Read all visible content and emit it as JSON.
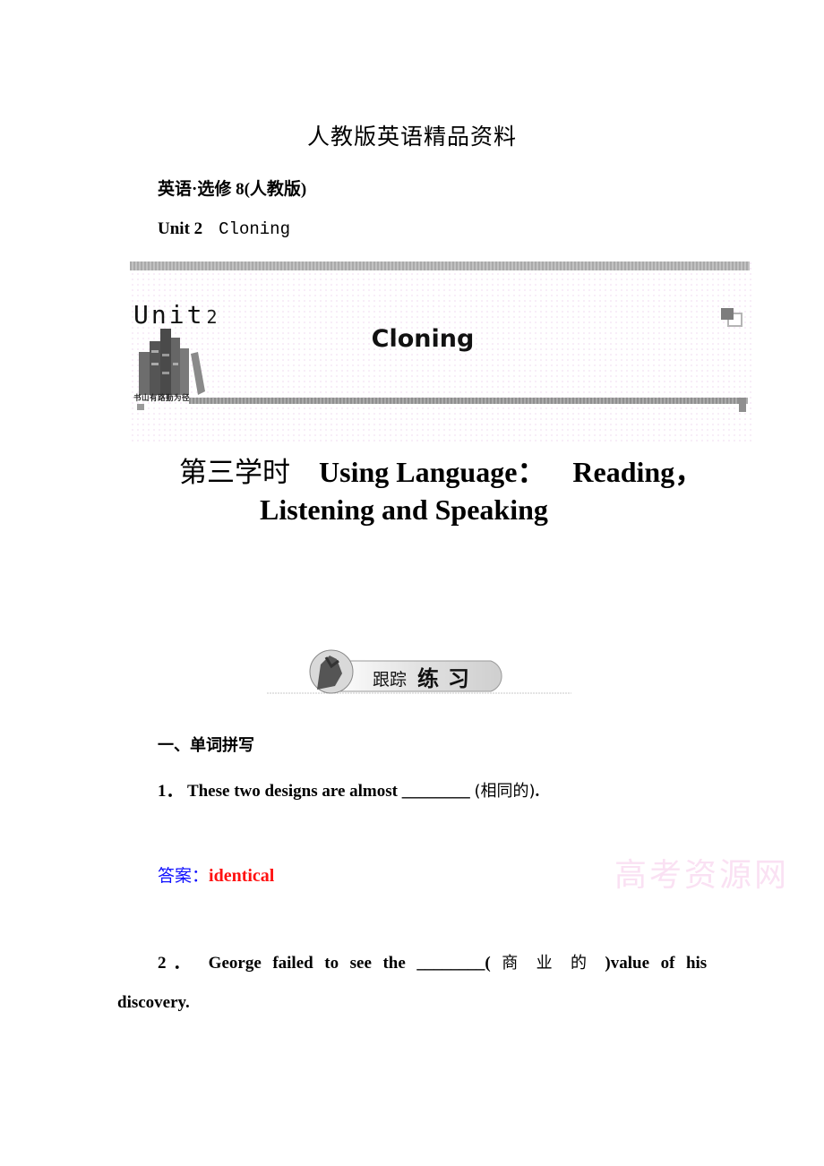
{
  "document": {
    "top_title": "人教版英语精品资料",
    "subject_line": "英语·选修 8(人教版)",
    "unit_line": {
      "unit": "Unit 2",
      "name": "Cloning"
    },
    "banner": {
      "logo_word": "Unit",
      "logo_number": "2",
      "motto": "书山有路勤为径",
      "title": "Cloning",
      "icons": [
        "books-icon",
        "squares-corner-icon"
      ]
    },
    "lesson_title": {
      "period": "第三学时",
      "line1_text": "Using Language：",
      "line1_tail": "Reading，",
      "line2": "Listening and Speaking"
    },
    "practice_badge": {
      "label_regular": "跟踪",
      "label_brush": "练习",
      "icon": "climber-icon"
    },
    "section": {
      "heading": "一、单词拼写"
    },
    "questions": [
      {
        "number": "1．",
        "text_before": "These two designs are almost",
        "blank": "________",
        "hint": "(相同的)",
        "text_after": "."
      },
      {
        "number": "2．",
        "words_line1": [
          "George",
          "failed",
          "to",
          "see",
          "the",
          "________(",
          "商",
          "业",
          "的",
          ")value",
          "of",
          "his"
        ],
        "line2": "discovery."
      }
    ],
    "answers": [
      {
        "label": "答案：",
        "value": "identical",
        "label_color": "#1010ff",
        "value_color": "#ff1010"
      }
    ],
    "watermark": "高考资源网"
  }
}
